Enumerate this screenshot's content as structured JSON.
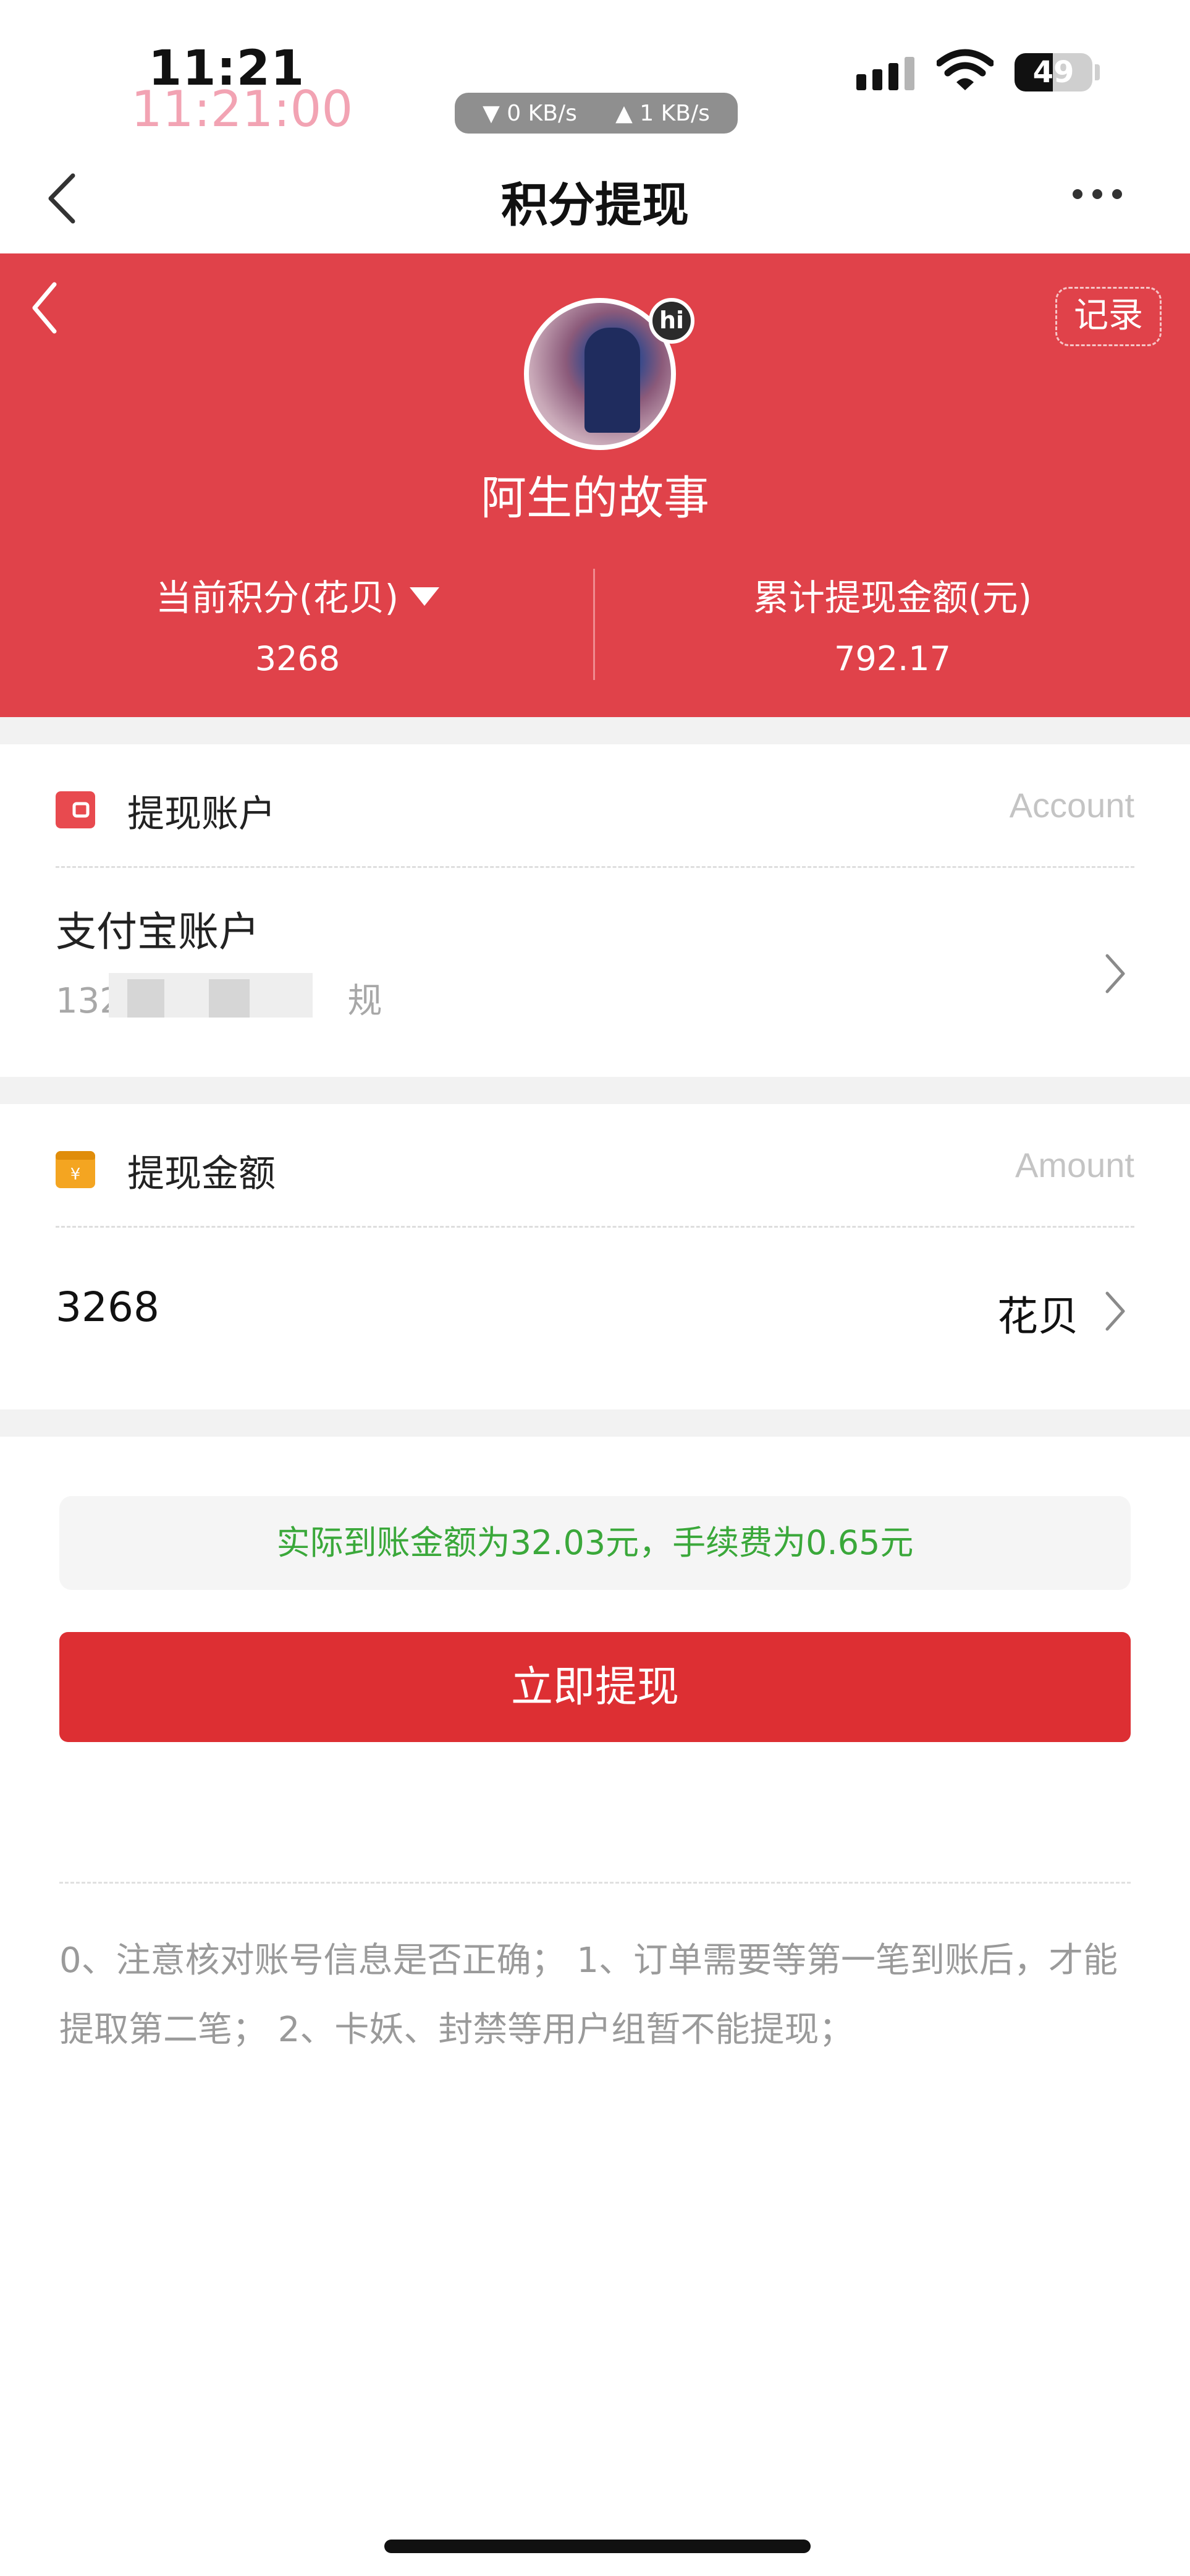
{
  "status_bar": {
    "time": "11:21",
    "time_overlay": "11:21:00",
    "download_speed": "▼ 0 KB/s",
    "upload_speed": "▲ 1 KB/s",
    "battery": "49",
    "battery_level_percent": 49
  },
  "nav": {
    "title": "积分提现",
    "back_icon": "chevron-left-icon",
    "more_icon": "more-dots-icon"
  },
  "header": {
    "records_label": "记录",
    "avatar_badge": "hi",
    "username": "阿生的故事",
    "points_label": "当前积分(花贝)",
    "points_value": "3268",
    "total_withdrawn_label": "累计提现金额(元)",
    "total_withdrawn_value": "792.17",
    "colors": {
      "accent": "#e0424a"
    }
  },
  "account_section": {
    "title": "提现账户",
    "hint": "Account",
    "icon": "wallet-icon",
    "account_name": "支付宝账户",
    "account_number_visible_prefix": "132",
    "account_number_visible_suffix": "规"
  },
  "amount_section": {
    "title": "提现金额",
    "hint": "Amount",
    "icon": "yuan-box-icon",
    "amount_value": "3268",
    "unit": "花贝"
  },
  "notice": {
    "text": "实际到账金额为32.03元，手续费为0.65元",
    "color": "#3aa83a"
  },
  "submit": {
    "label": "立即提现",
    "color": "#dd2f33"
  },
  "tips": {
    "text": "0、注意核对账号信息是否正确； 1、订单需要等第一笔到账后，才能提取第二笔； 2、卡妖、封禁等用户组暂不能提现；"
  }
}
